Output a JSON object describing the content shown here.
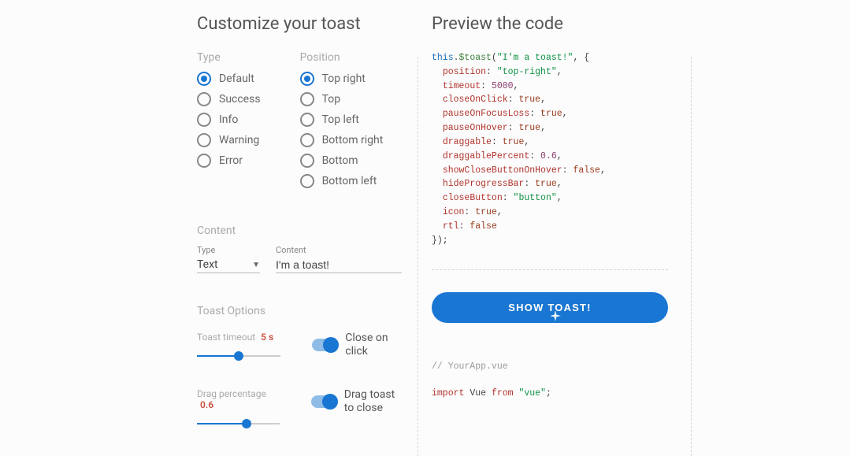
{
  "headings": {
    "customize": "Customize your toast",
    "preview": "Preview the code"
  },
  "type": {
    "label": "Type",
    "selected": 0,
    "options": [
      "Default",
      "Success",
      "Info",
      "Warning",
      "Error"
    ]
  },
  "position": {
    "label": "Position",
    "selected": 0,
    "options": [
      "Top right",
      "Top",
      "Top left",
      "Bottom right",
      "Bottom",
      "Bottom left"
    ]
  },
  "content": {
    "label": "Content",
    "typeField": {
      "label": "Type",
      "value": "Text"
    },
    "contentField": {
      "label": "Content",
      "value": "I'm a toast!"
    }
  },
  "options": {
    "label": "Toast Options",
    "timeout": {
      "label": "Toast timeout",
      "value": "5 s",
      "percent": 50
    },
    "closeOnClick": {
      "label": "Close on click",
      "on": true
    },
    "dragPercent": {
      "label": "Drag percentage",
      "value": "0.6",
      "percent": 60
    },
    "dragClose": {
      "label": "Drag toast to close",
      "on": true
    }
  },
  "code": {
    "this": "this",
    "fn": "$toast",
    "msg": "\"I'm a toast!\"",
    "lines": [
      {
        "k": "position",
        "v": "\"top-right\"",
        "t": "str"
      },
      {
        "k": "timeout",
        "v": "5000",
        "t": "num"
      },
      {
        "k": "closeOnClick",
        "v": "true",
        "t": "bool"
      },
      {
        "k": "pauseOnFocusLoss",
        "v": "true",
        "t": "bool"
      },
      {
        "k": "pauseOnHover",
        "v": "true",
        "t": "bool"
      },
      {
        "k": "draggable",
        "v": "true",
        "t": "bool"
      },
      {
        "k": "draggablePercent",
        "v": "0.6",
        "t": "num"
      },
      {
        "k": "showCloseButtonOnHover",
        "v": "false",
        "t": "bool"
      },
      {
        "k": "hideProgressBar",
        "v": "true",
        "t": "bool"
      },
      {
        "k": "closeButton",
        "v": "\"button\"",
        "t": "str"
      },
      {
        "k": "icon",
        "v": "true",
        "t": "bool"
      },
      {
        "k": "rtl",
        "v": "false",
        "t": "bool"
      }
    ]
  },
  "button": {
    "label": "SHOW TOAST!"
  },
  "snippet2": {
    "comment": "// YourApp.vue",
    "importLine": {
      "kw": "import",
      "id": "Vue",
      "from": "from",
      "mod": "\"vue\""
    }
  }
}
